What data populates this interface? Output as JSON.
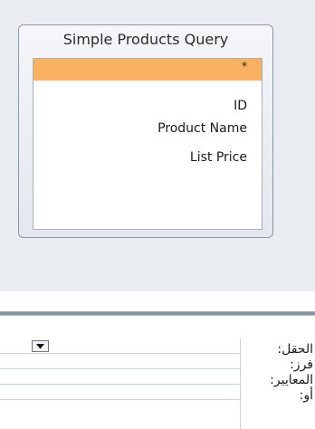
{
  "design_pane": {
    "table": {
      "title": "Simple Products Query",
      "fields": [
        {
          "label": "*",
          "selected": true
        },
        {
          "label": "ID",
          "selected": false
        },
        {
          "label": "Product Name",
          "selected": false
        },
        {
          "label": "List Price",
          "selected": false
        }
      ]
    }
  },
  "grid": {
    "row_labels": [
      "الحقل:",
      "فرز:",
      "المعايير:",
      "أو:"
    ],
    "dropdown_icon": "chevron-down-icon"
  },
  "colors": {
    "selected_field": "#f7b161",
    "design_background": "#e9edf2"
  }
}
